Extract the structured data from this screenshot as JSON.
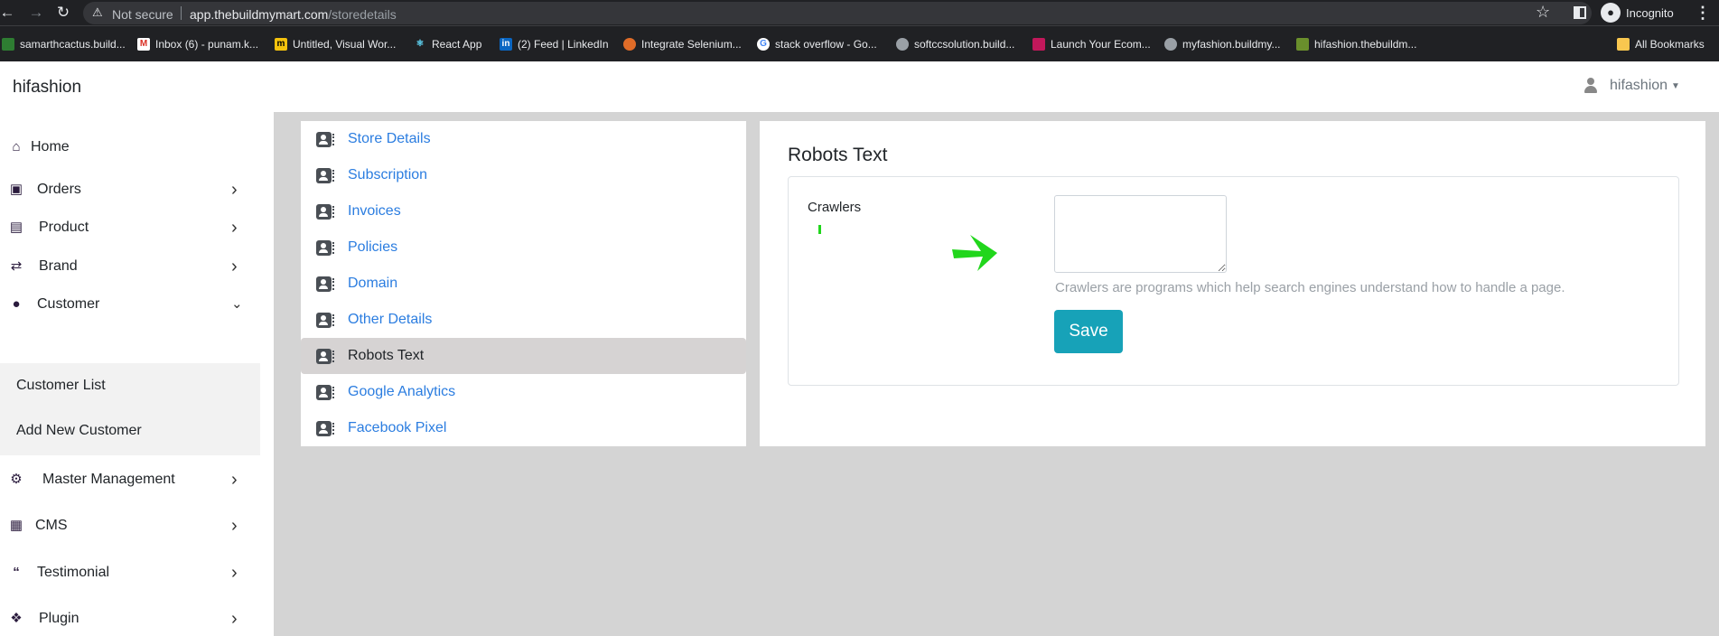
{
  "browser": {
    "security_label": "Not secure",
    "url_host": "app.thebuildmymart.com",
    "url_path": "/storedetails",
    "profile_label": "Incognito",
    "bookmarks": [
      {
        "label": "samarthcactus.build..."
      },
      {
        "label": "Inbox (6) - punam.k..."
      },
      {
        "label": "Untitled, Visual Wor..."
      },
      {
        "label": "React App"
      },
      {
        "label": "(2) Feed | LinkedIn"
      },
      {
        "label": "Integrate Selenium..."
      },
      {
        "label": "stack overflow - Go..."
      },
      {
        "label": "softccsolution.build..."
      },
      {
        "label": "Launch Your Ecom..."
      },
      {
        "label": "myfashion.buildmy..."
      },
      {
        "label": "hifashion.thebuildm..."
      }
    ],
    "all_bookmarks_label": "All Bookmarks"
  },
  "header": {
    "brand": "hifashion",
    "user_name": "hifashion"
  },
  "sidebar": {
    "items": [
      {
        "label": "Home",
        "icon": "home-icon"
      },
      {
        "label": "Orders",
        "icon": "shopping-bag-icon"
      },
      {
        "label": "Product",
        "icon": "archive-icon"
      },
      {
        "label": "Brand",
        "icon": "random-icon"
      },
      {
        "label": "Customer",
        "icon": "user-icon"
      },
      {
        "label": "Master Management",
        "icon": "user-cog-icon"
      },
      {
        "label": "CMS",
        "icon": "file-icon"
      },
      {
        "label": "Testimonial",
        "icon": "quote-icon"
      },
      {
        "label": "Plugin",
        "icon": "puzzle-icon"
      }
    ],
    "customer_submenu": [
      {
        "label": "Customer List"
      },
      {
        "label": "Add New Customer"
      }
    ]
  },
  "store_nav": {
    "items": [
      {
        "label": "Store Details"
      },
      {
        "label": "Subscription"
      },
      {
        "label": "Invoices"
      },
      {
        "label": "Policies"
      },
      {
        "label": "Domain"
      },
      {
        "label": "Other Details"
      },
      {
        "label": "Robots Text"
      },
      {
        "label": "Google Analytics"
      },
      {
        "label": "Facebook Pixel"
      }
    ],
    "active": "Robots Text"
  },
  "main": {
    "title": "Robots Text",
    "field_label": "Crawlers",
    "field_value": "",
    "help_text": "Crawlers are programs which help search engines understand how to handle a page.",
    "save_label": "Save"
  },
  "colors": {
    "accent": "#17a2b8",
    "link": "#2b7de0",
    "annotation": "#21d61c"
  }
}
